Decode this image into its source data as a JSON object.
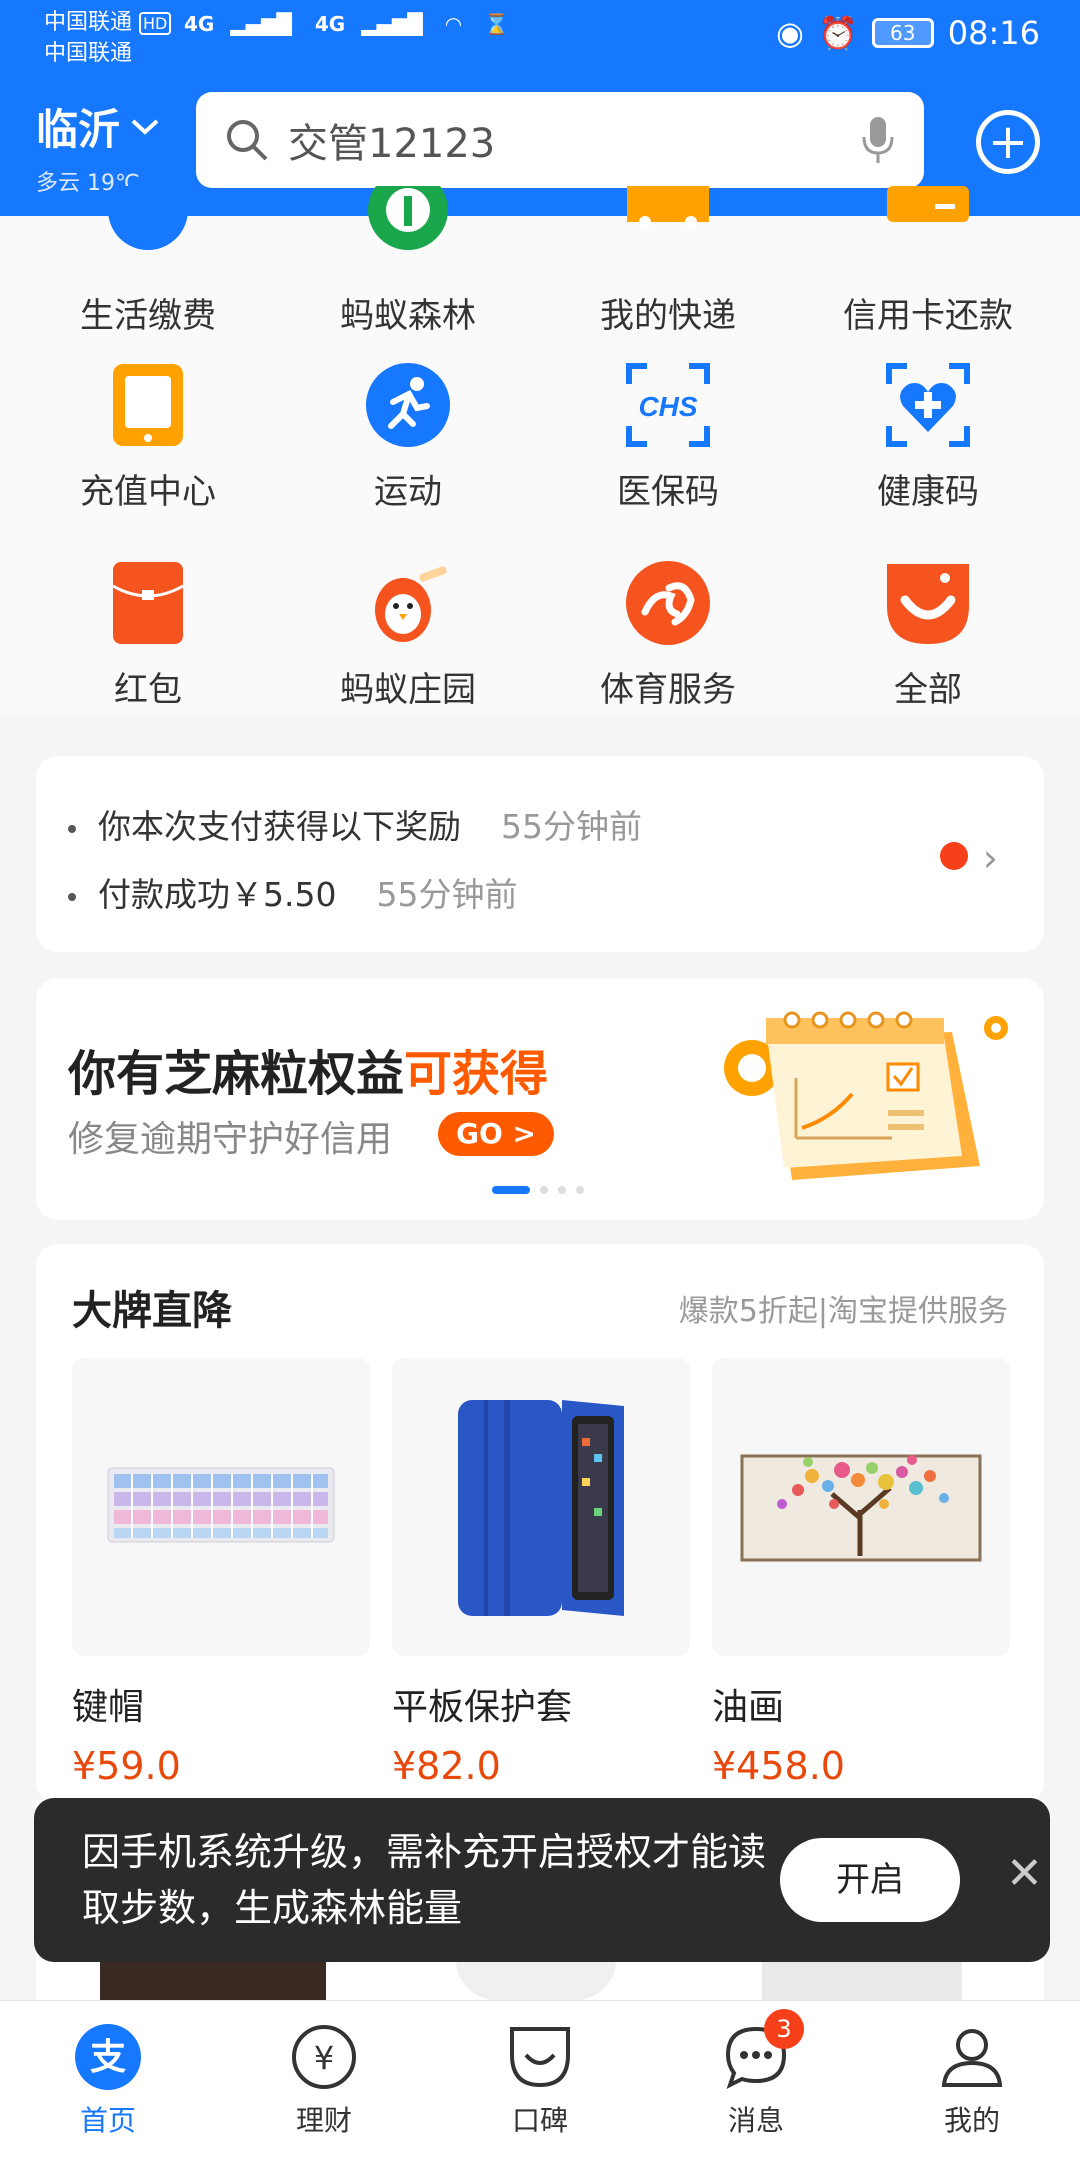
{
  "status": {
    "carrier1": "中国联通",
    "carrier2": "中国联通",
    "hd": "HD",
    "net1": "4G",
    "net2": "4G",
    "battery": "63",
    "time": "08:16"
  },
  "header": {
    "city": "临沂",
    "weather": "多云 19℃",
    "search_text": "交管12123"
  },
  "grid": [
    {
      "label": "生活缴费",
      "icon": "bill-icon"
    },
    {
      "label": "蚂蚁森林",
      "icon": "forest-icon"
    },
    {
      "label": "我的快递",
      "icon": "express-icon"
    },
    {
      "label": "信用卡还款",
      "icon": "credit-card-icon"
    },
    {
      "label": "充值中心",
      "icon": "phone-recharge-icon"
    },
    {
      "label": "运动",
      "icon": "sport-icon"
    },
    {
      "label": "医保码",
      "icon": "medical-insurance-icon"
    },
    {
      "label": "健康码",
      "icon": "health-code-icon"
    },
    {
      "label": "红包",
      "icon": "red-packet-icon"
    },
    {
      "label": "蚂蚁庄园",
      "icon": "farm-chick-icon"
    },
    {
      "label": "体育服务",
      "icon": "sports-service-icon"
    },
    {
      "label": "全部",
      "icon": "all-services-icon"
    }
  ],
  "notice": {
    "line1": "你本次支付获得以下奖励",
    "time1": "55分钟前",
    "line2": "付款成功￥5.50",
    "time2": "55分钟前"
  },
  "promo": {
    "title_a": "你有芝麻粒权益",
    "title_b": "可获得",
    "subtitle": "修复逾期守护好信用",
    "go": "GO >"
  },
  "brand": {
    "title": "大牌直降",
    "subtitle": "爆款5折起|淘宝提供服务",
    "products": [
      {
        "name": "键帽",
        "price": "¥59.0"
      },
      {
        "name": "平板保护套",
        "price": "¥82.0"
      },
      {
        "name": "油画",
        "price": "¥458.0"
      }
    ]
  },
  "toast": {
    "text": "因手机系统升级，需补充开启授权才能读取步数，生成森林能量",
    "button": "开启"
  },
  "tabs": [
    {
      "label": "首页"
    },
    {
      "label": "理财"
    },
    {
      "label": "口碑"
    },
    {
      "label": "消息",
      "badge": "3"
    },
    {
      "label": "我的"
    }
  ],
  "colors": {
    "brand_blue": "#1677ff",
    "accent_orange": "#ff5a00",
    "price_red": "#e8490b"
  }
}
